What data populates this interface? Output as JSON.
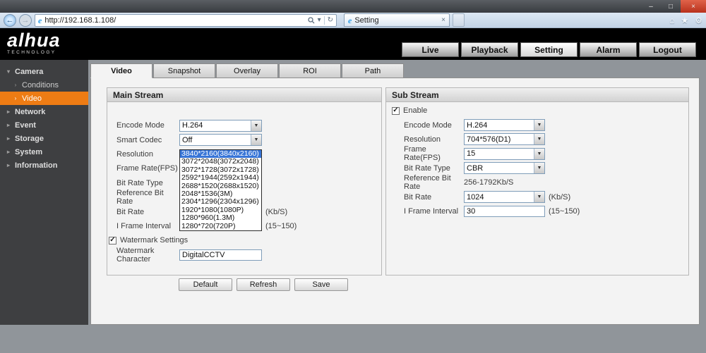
{
  "icons": {
    "minimize": "–",
    "maximize": "□",
    "close": "×",
    "back": "←",
    "forward": "→",
    "dropdown": "▾",
    "refresh": "↻",
    "home": "⌂",
    "favorites": "★",
    "tools": "⚙",
    "tab_close": "×",
    "ie": "e",
    "group_open": "▾",
    "group_closed": "▸",
    "sub_arrow": "›",
    "select_arrow": "▼",
    "check": "✓"
  },
  "browser": {
    "url": "http://192.168.1.108/",
    "tab_title": "Setting"
  },
  "brand": {
    "logo": "alhua",
    "logo_sub": "TECHNOLOGY",
    "nav": [
      {
        "label": "Live"
      },
      {
        "label": "Playback"
      },
      {
        "label": "Setting"
      },
      {
        "label": "Alarm"
      },
      {
        "label": "Logout"
      }
    ]
  },
  "sidebar": {
    "items": [
      {
        "label": "Camera",
        "kind": "group-open"
      },
      {
        "label": "Conditions",
        "kind": "sub"
      },
      {
        "label": "Video",
        "kind": "sub",
        "selected": true
      },
      {
        "label": "Network",
        "kind": "group"
      },
      {
        "label": "Event",
        "kind": "group"
      },
      {
        "label": "Storage",
        "kind": "group"
      },
      {
        "label": "System",
        "kind": "group"
      },
      {
        "label": "Information",
        "kind": "group"
      }
    ]
  },
  "tabs": [
    {
      "label": "Video",
      "active": true
    },
    {
      "label": "Snapshot"
    },
    {
      "label": "Overlay"
    },
    {
      "label": "ROI"
    },
    {
      "label": "Path"
    }
  ],
  "main_stream": {
    "title": "Main Stream",
    "fields": {
      "encode_mode": {
        "label": "Encode Mode",
        "value": "H.264"
      },
      "smart_codec": {
        "label": "Smart Codec",
        "value": "Off"
      },
      "resolution": {
        "label": "Resolution"
      },
      "frame_rate": {
        "label": "Frame Rate(FPS)"
      },
      "bit_rate_type": {
        "label": "Bit Rate Type"
      },
      "reference_bit_rate": {
        "label": "Reference Bit Rate"
      },
      "bit_rate": {
        "label": "Bit Rate",
        "suffix": "(Kb/S)"
      },
      "i_frame_interval": {
        "label": "I Frame Interval",
        "suffix": "(15~150)"
      },
      "watermark_settings": {
        "label": "Watermark Settings",
        "checked": true
      },
      "watermark_character": {
        "label": "Watermark Character",
        "value": "DigitalCCTV"
      }
    },
    "resolution_dropdown": {
      "selected": "3840*2160(3840x2160)",
      "options": [
        "3840*2160(3840x2160)",
        "3072*2048(3072x2048)",
        "3072*1728(3072x1728)",
        "2592*1944(2592x1944)",
        "2688*1520(2688x1520)",
        "2048*1536(3M)",
        "2304*1296(2304x1296)",
        "1920*1080(1080P)",
        "1280*960(1.3M)",
        "1280*720(720P)"
      ]
    }
  },
  "sub_stream": {
    "title": "Sub Stream",
    "enable": {
      "label": "Enable",
      "checked": true
    },
    "fields": {
      "encode_mode": {
        "label": "Encode Mode",
        "value": "H.264"
      },
      "resolution": {
        "label": "Resolution",
        "value": "704*576(D1)"
      },
      "frame_rate": {
        "label": "Frame Rate(FPS)",
        "value": "15"
      },
      "bit_rate_type": {
        "label": "Bit Rate Type",
        "value": "CBR"
      },
      "reference_bit_rate": {
        "label": "Reference Bit Rate",
        "value": "256-1792Kb/S"
      },
      "bit_rate": {
        "label": "Bit Rate",
        "value": "1024",
        "suffix": "(Kb/S)"
      },
      "i_frame_interval": {
        "label": "I Frame Interval",
        "value": "30",
        "suffix": "(15~150)"
      }
    }
  },
  "actions": {
    "default": "Default",
    "refresh": "Refresh",
    "save": "Save"
  },
  "colors": {
    "accent_orange": "#ee7c14",
    "selection_blue": "#3875d7",
    "brand_black": "#000000"
  }
}
